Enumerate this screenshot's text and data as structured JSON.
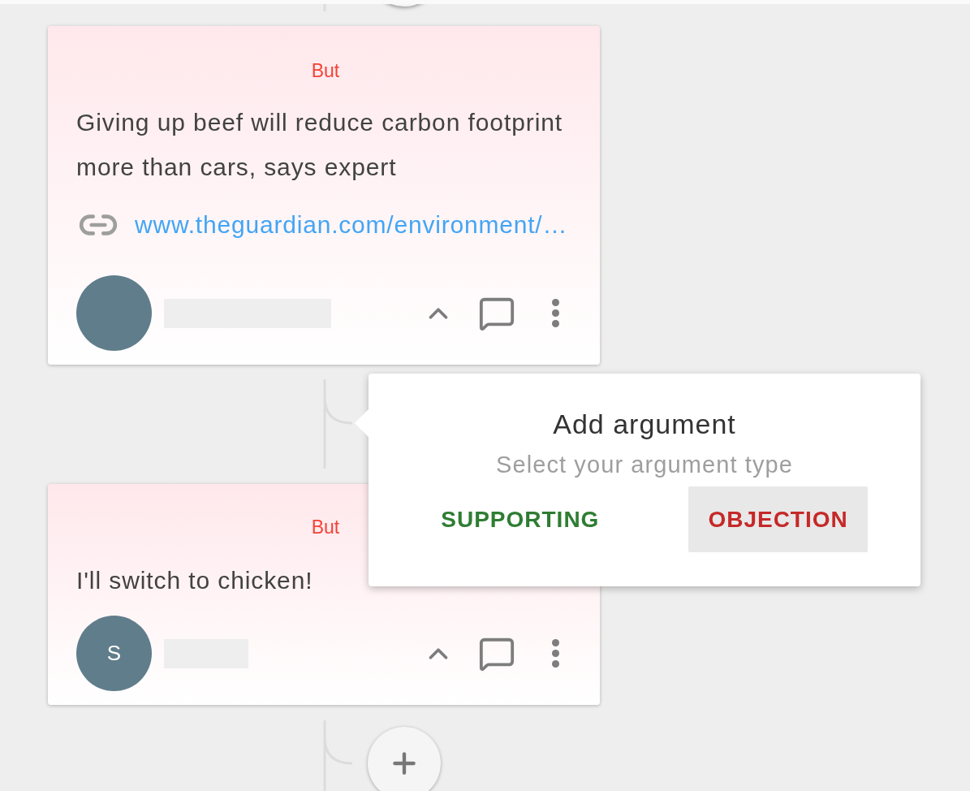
{
  "cards": [
    {
      "label": "But",
      "title": "Giving up beef will reduce carbon footprint more than cars, says expert",
      "link": "www.theguardian.com/environment/…"
    },
    {
      "label": "But",
      "title": "I'll switch to chicken!",
      "avatar": "S"
    }
  ],
  "popover": {
    "title": "Add argument",
    "subtitle": "Select your argument type",
    "options": [
      {
        "kind": "supporting",
        "label": "SUPPORTING",
        "selected": false
      },
      {
        "kind": "objection",
        "label": "OBJECTION",
        "selected": true
      }
    ]
  }
}
